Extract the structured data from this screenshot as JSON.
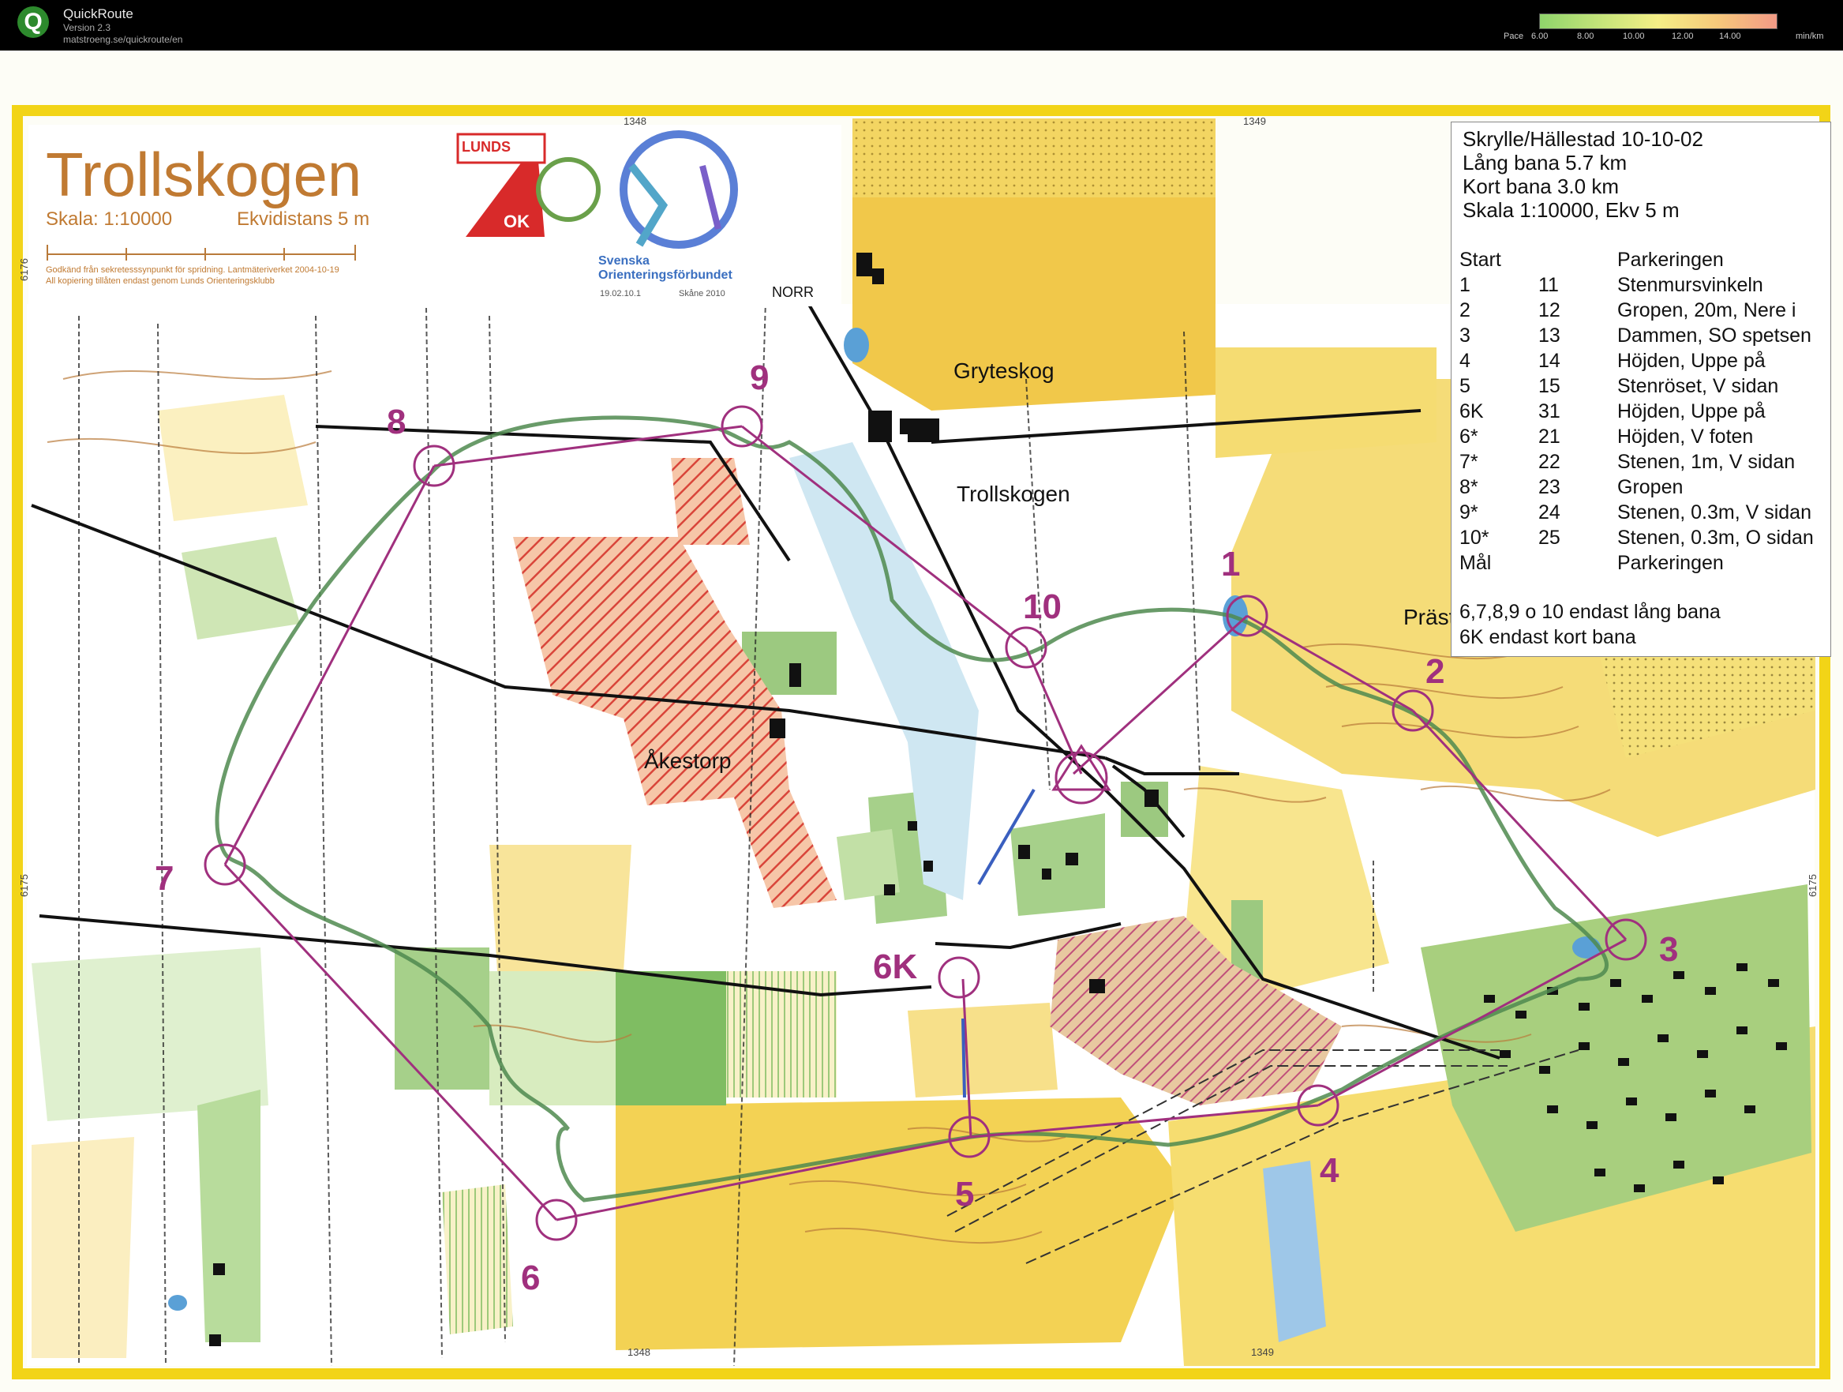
{
  "app": {
    "name": "QuickRoute",
    "version": "Version 2.3",
    "url": "matstroeng.se/quickroute/en",
    "logo_letter": "Q"
  },
  "pace_legend": {
    "label": "Pace",
    "ticks": [
      "6.00",
      "8.00",
      "10.00",
      "12.00",
      "14.00"
    ],
    "unit": "min/km"
  },
  "map_header": {
    "title": "Trollskogen",
    "scale": "Skala: 1:10000",
    "equidistance": "Ekvidistans 5 m",
    "note1": "Godkänd från sekretesssynpunkt för spridning. Lantmäteriverket 2004-10-19",
    "note2": "All kopiering tillåten endast genom Lunds Orienteringsklubb",
    "club_top": "LUNDS",
    "club_bottom": "OK",
    "federation": "Svenska Orienteringsförbundet",
    "permit": "19.02.10.1",
    "region": "Skåne 2010",
    "north": "NORR"
  },
  "grid_labels": {
    "top_1348": "1348",
    "top_1349": "1349",
    "bottom_1348": "1348",
    "bottom_1349": "1349",
    "left_6176": "6176",
    "left_6175": "6175",
    "right_6175": "6175"
  },
  "place_names": {
    "gryteskog": "Gryteskog",
    "trollskogen": "Trollskogen",
    "akestorp": "Åkestorp",
    "prastskogen": "Prästskogen"
  },
  "controls": [
    "1",
    "2",
    "3",
    "4",
    "5",
    "6K",
    "6",
    "7",
    "8",
    "9",
    "10"
  ],
  "info": {
    "line1": "Skrylle/Hällestad  10-10-02",
    "line2": "Lång bana 5.7 km",
    "line3": "Kort bana 3.0 km",
    "line4": "Skala 1:10000, Ekv 5 m",
    "start_label": "Start",
    "start_desc": "Parkeringen",
    "rows": [
      {
        "num": "1",
        "code": "11",
        "desc": "Stenmursvinkeln"
      },
      {
        "num": "2",
        "code": "12",
        "desc": "Gropen, 20m, Nere i"
      },
      {
        "num": "3",
        "code": "13",
        "desc": "Dammen, SO spetsen"
      },
      {
        "num": "4",
        "code": "14",
        "desc": "Höjden, Uppe på"
      },
      {
        "num": "5",
        "code": "15",
        "desc": "Stenröset, V sidan"
      },
      {
        "num": "6K",
        "code": "31",
        "desc": "Höjden, Uppe på"
      },
      {
        "num": "6*",
        "code": "21",
        "desc": "Höjden, V foten"
      },
      {
        "num": "7*",
        "code": "22",
        "desc": "Stenen, 1m, V sidan"
      },
      {
        "num": "8*",
        "code": "23",
        "desc": "Gropen"
      },
      {
        "num": "9*",
        "code": "24",
        "desc": "Stenen, 0.3m, V sidan"
      },
      {
        "num": "10*",
        "code": "25",
        "desc": "Stenen, 0.3m, O sidan"
      }
    ],
    "finish_label": "Mål",
    "finish_desc": "Parkeringen",
    "note_long": "6,7,8,9 o 10 endast lång bana",
    "note_short": "6K endast kort bana"
  },
  "colors": {
    "course": "#a0307e",
    "route": "#4f8a4f",
    "open": "#f3cf3a",
    "rough_open": "#f9e9a2",
    "green": "#8fc46a",
    "water": "#5aa0d6",
    "contour": "#b97a3a",
    "border": "#f2d417"
  }
}
